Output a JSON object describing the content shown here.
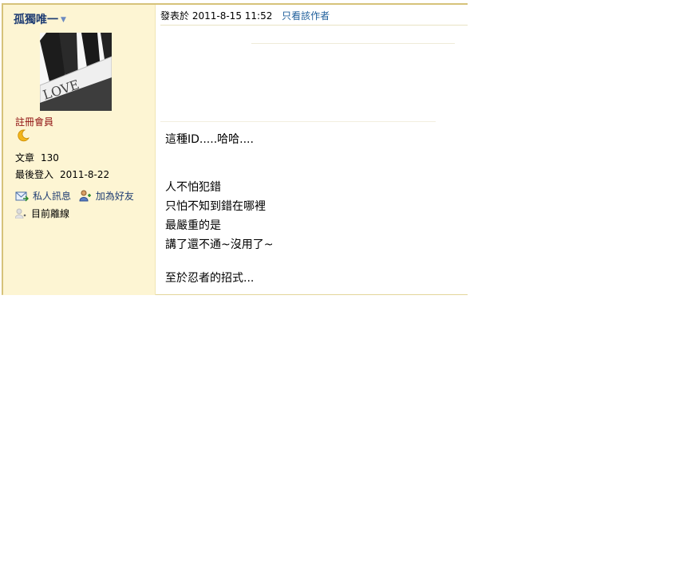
{
  "post": {
    "author": "孤獨唯一",
    "group": "註冊會員",
    "stats": [
      {
        "label": "文章",
        "value": "130"
      },
      {
        "label": "最後登入",
        "value": "2011-8-22"
      }
    ],
    "actions": {
      "pm": "私人訊息",
      "add_friend": "加為好友"
    },
    "online_status": "目前離線",
    "posted_label": "發表於",
    "posted_time": "2011-8-15 11:52",
    "author_only_link": "只看該作者",
    "lines_a": [
      "這種ID.....哈哈...."
    ],
    "lines_b": [
      "人不怕犯錯",
      "只怕不知到錯在哪裡",
      "最嚴重的是",
      "講了還不通~沒用了~"
    ],
    "lines_c": [
      "至於忍者的招式..."
    ],
    "avatar_text": "LOVE"
  },
  "colors": {
    "sidebar_bg": "#fdf5d3",
    "author": "#1f3d73",
    "group": "#8f1111",
    "link": "#1f5f9b",
    "border": "#d6c27a"
  }
}
